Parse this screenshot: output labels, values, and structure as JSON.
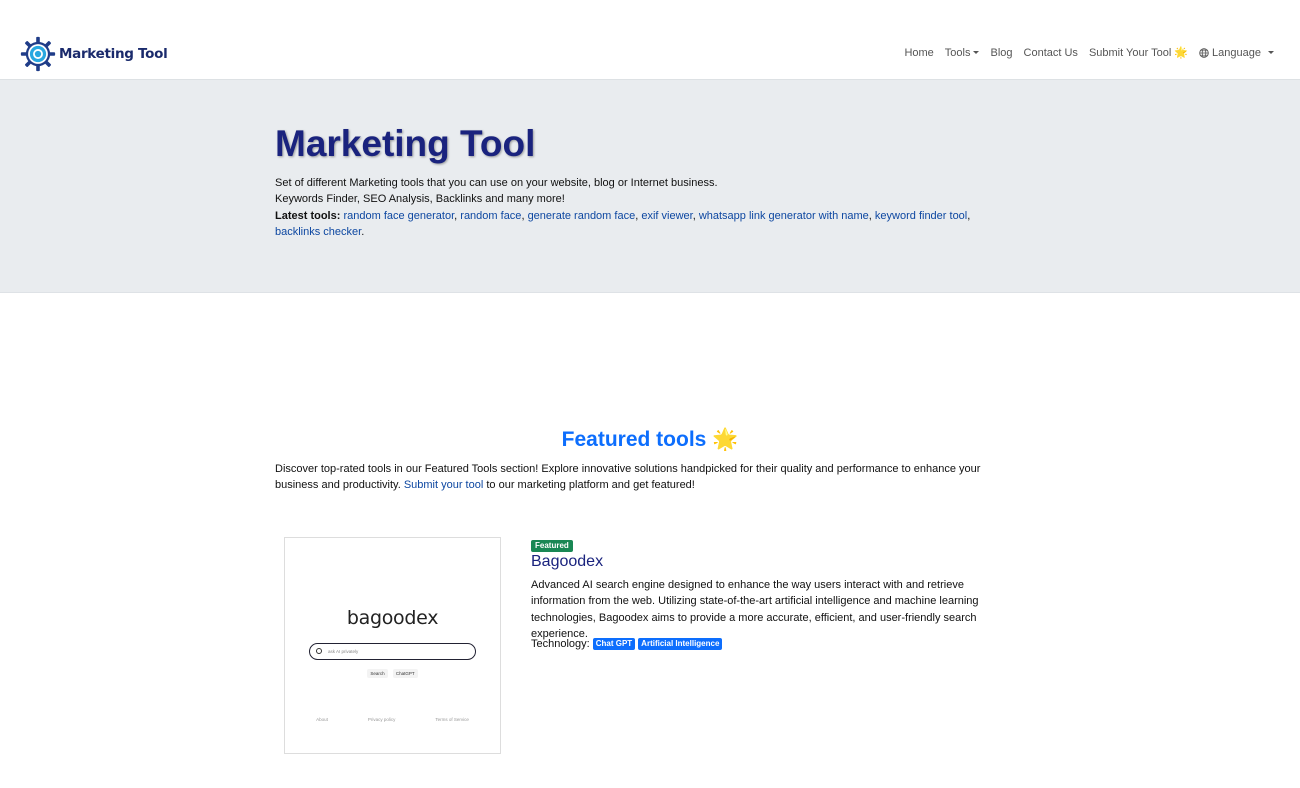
{
  "navbar": {
    "brand": "Marketing Tool",
    "items": [
      {
        "label": "Home"
      },
      {
        "label": "Tools"
      },
      {
        "label": "Blog"
      },
      {
        "label": "Contact Us"
      },
      {
        "label": "Submit Your Tool 🌟"
      },
      {
        "label": "Language"
      }
    ]
  },
  "hero": {
    "title": "Marketing Tool",
    "line1": "Set of different Marketing tools that you can use on your website, blog or Internet business.",
    "line2": "Keywords Finder, SEO Analysis, Backlinks and many more!",
    "latest_label": "Latest tools:",
    "latest_tools": [
      "random face generator",
      "random face",
      "generate random face",
      "exif viewer",
      "whatsapp link generator with name",
      "keyword finder tool",
      "backlinks checker"
    ]
  },
  "featured": {
    "title": "Featured tools 🌟",
    "desc_before": "Discover top-rated tools in our Featured Tools section! Explore innovative solutions handpicked for their quality and performance to enhance your business and productivity. ",
    "desc_link": "Submit your tool",
    "desc_after": " to our marketing platform and get featured!"
  },
  "tool": {
    "badge": "Featured",
    "name": "Bagoodex",
    "description": "Advanced AI search engine designed to enhance the way users interact with and retrieve information from the web. Utilizing state-of-the-art artificial intelligence and machine learning technologies, Bagoodex aims to provide a more accurate, efficient, and user-friendly search experience.",
    "tech_label": "Technology:",
    "tech_tags": [
      "Chat GPT",
      "Artificial Intelligence"
    ],
    "thumbnail": {
      "logo": "bagoodex",
      "search_placeholder": "ask AI privately",
      "buttons": [
        "Search",
        "ChatGPT"
      ],
      "footer": [
        "About",
        "Privacy policy",
        "Terms of Service"
      ]
    }
  }
}
